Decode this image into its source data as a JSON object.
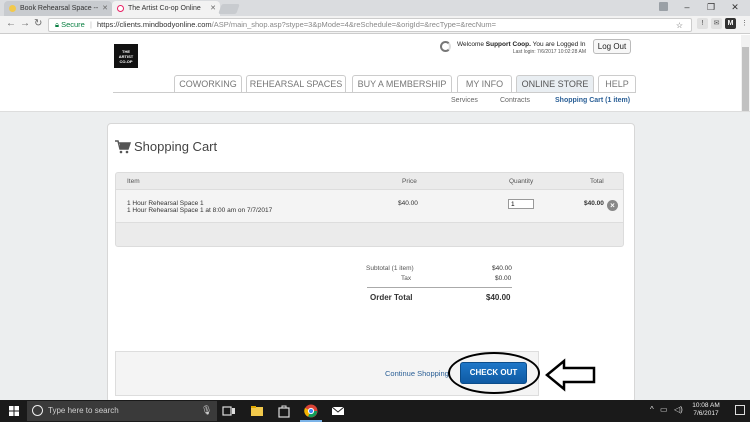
{
  "browser": {
    "tabs": [
      {
        "title": "Book Rehearsal Space -- ",
        "favicon_color": "#f2c94c",
        "active": false
      },
      {
        "title": "The Artist Co-op Online ",
        "favicon_color": "#e91e63",
        "active": true
      }
    ],
    "url": {
      "secure_label": "Secure",
      "host": "https://clients.mindbodyonline.com",
      "path": "/ASP/main_shop.asp?stype=3&pMode=4&reSchedule=&origId=&recType=&recNum="
    }
  },
  "site": {
    "logo_text": [
      "THE",
      "ARTIST",
      "CO-OP"
    ],
    "welcome_prefix": "Welcome ",
    "user_name": "Support Coop.",
    "welcome_suffix": " You are Logged In",
    "last_login": "Last login: 7/6/2017 10:02:28 AM",
    "logout_label": "Log Out",
    "nav": [
      "COWORKING",
      "REHEARSAL SPACES",
      "BUY A MEMBERSHIP",
      "MY INFO",
      "ONLINE STORE",
      "HELP"
    ],
    "active_nav": "ONLINE STORE",
    "subnav": [
      "Services",
      "Contracts",
      "Shopping Cart (1 item)"
    ],
    "active_subnav": "Shopping Cart (1 item)"
  },
  "cart": {
    "title": "Shopping Cart",
    "columns": {
      "item": "Item",
      "price": "Price",
      "quantity": "Quantity",
      "total": "Total"
    },
    "items": [
      {
        "name": "1 Hour Rehearsal Space 1",
        "detail": "1 Hour Rehearsal Space 1 at 8:00 am on 7/7/2017",
        "price": "$40.00",
        "quantity": "1",
        "total": "$40.00"
      }
    ],
    "summary": {
      "subtotal_label": "Subtotal  (1 item)",
      "subtotal": "$40.00",
      "tax_label": "Tax",
      "tax": "$0.00",
      "order_total_label": "Order Total",
      "order_total": "$40.00"
    },
    "continue_label": "Continue Shopping",
    "checkout_label": "CHECK OUT",
    "accent": "#1565b8"
  },
  "taskbar": {
    "search_placeholder": "Type here to search",
    "time": "10:08 AM",
    "date": "7/6/2017"
  }
}
